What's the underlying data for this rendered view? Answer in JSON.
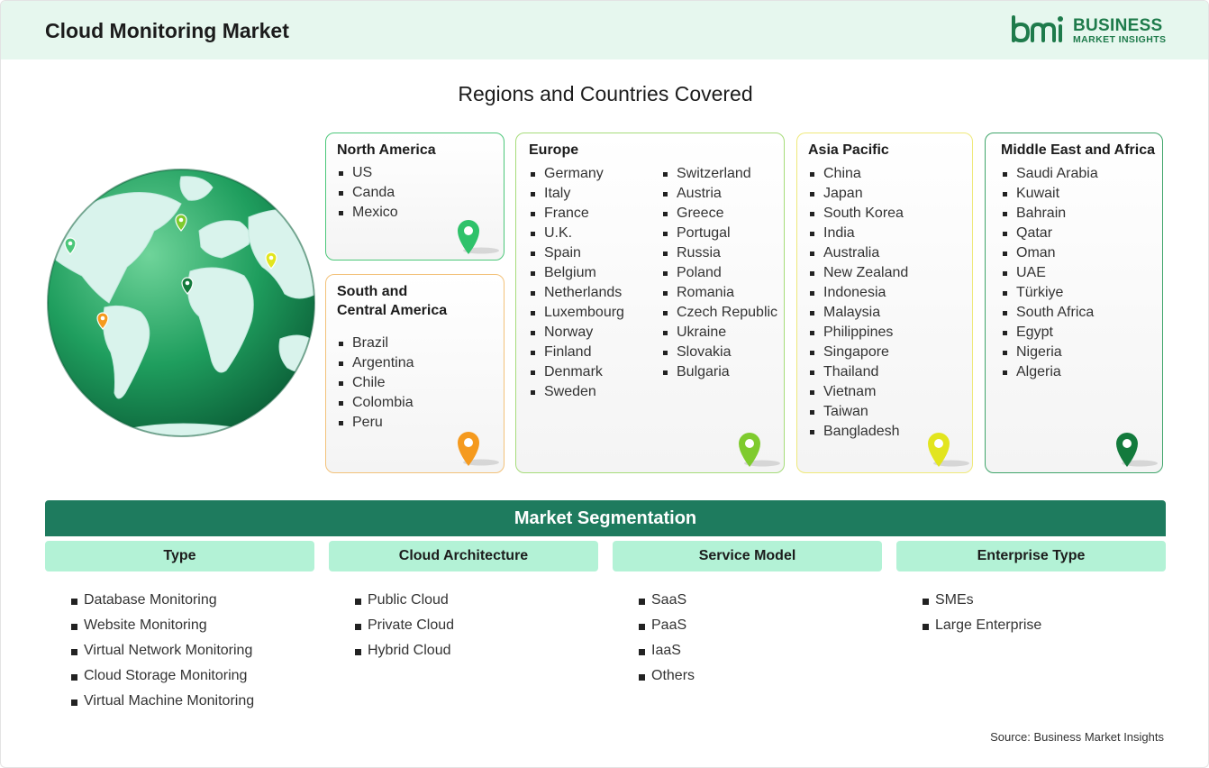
{
  "header": {
    "title": "Cloud Monitoring Market"
  },
  "logo": {
    "line1": "BUSINESS",
    "line2": "MARKET INSIGHTS",
    "color": "#1e7b4b"
  },
  "regions_title": "Regions and Countries Covered",
  "regions": [
    {
      "name": "North America",
      "color": "#4cc77a",
      "pin_color": "#2fc26a",
      "items": [
        "US",
        "Canda",
        "Mexico"
      ]
    },
    {
      "name": "South and Central America",
      "color": "#f3c27a",
      "pin_color": "#f59a1e",
      "items": [
        "Brazil",
        "Argentina",
        "Chile",
        "Colombia",
        "Peru"
      ]
    },
    {
      "name": "Europe",
      "color": "#a6dc7a",
      "pin_color": "#7fcb2e",
      "items_col1": [
        "Germany",
        "Italy",
        "France",
        "U.K.",
        "Spain",
        "Belgium",
        "Netherlands",
        "Luxembourg",
        "Norway",
        "Finland",
        "Denmark",
        "Sweden"
      ],
      "items_col2": [
        "Switzerland",
        "Austria",
        "Greece",
        "Portugal",
        "Russia",
        "Poland",
        "Romania",
        "Czech Republic",
        "Ukraine",
        "Slovakia",
        "Bulgaria"
      ]
    },
    {
      "name": "Asia Pacific",
      "color": "#efe97a",
      "pin_color": "#e2e51e",
      "items": [
        "China",
        "Japan",
        "South Korea",
        "India",
        "Australia",
        "New Zealand",
        "Indonesia",
        "Malaysia",
        "Philippines",
        "Singapore",
        "Thailand",
        "Vietnam",
        "Taiwan",
        "Bangladesh"
      ]
    },
    {
      "name": "Middle East and Africa",
      "color": "#3fa56a",
      "pin_color": "#137a3c",
      "items": [
        "Saudi Arabia",
        "Kuwait",
        "Bahrain",
        "Qatar",
        "Oman",
        "UAE",
        "Türkiye",
        "South Africa",
        "Egypt",
        "Nigeria",
        "Algeria"
      ]
    }
  ],
  "segmentation": {
    "title": "Market Segmentation",
    "columns": [
      {
        "heading": "Type",
        "items": [
          "Database Monitoring",
          "Website Monitoring",
          "Virtual Network Monitoring",
          "Cloud Storage Monitoring",
          "Virtual Machine Monitoring"
        ]
      },
      {
        "heading": "Cloud Architecture",
        "items": [
          "Public Cloud",
          "Private Cloud",
          "Hybrid Cloud"
        ]
      },
      {
        "heading": "Service Model",
        "items": [
          "SaaS",
          "PaaS",
          "IaaS",
          "Others"
        ]
      },
      {
        "heading": "Enterprise Type",
        "items": [
          "SMEs",
          "Large Enterprise"
        ]
      }
    ]
  },
  "source": "Source: Business Market Insights",
  "colors": {
    "header_bg": "#e6f7ee",
    "segmentation_bar": "#1e7b5e",
    "segment_head_bg": "#b3f2d6"
  }
}
